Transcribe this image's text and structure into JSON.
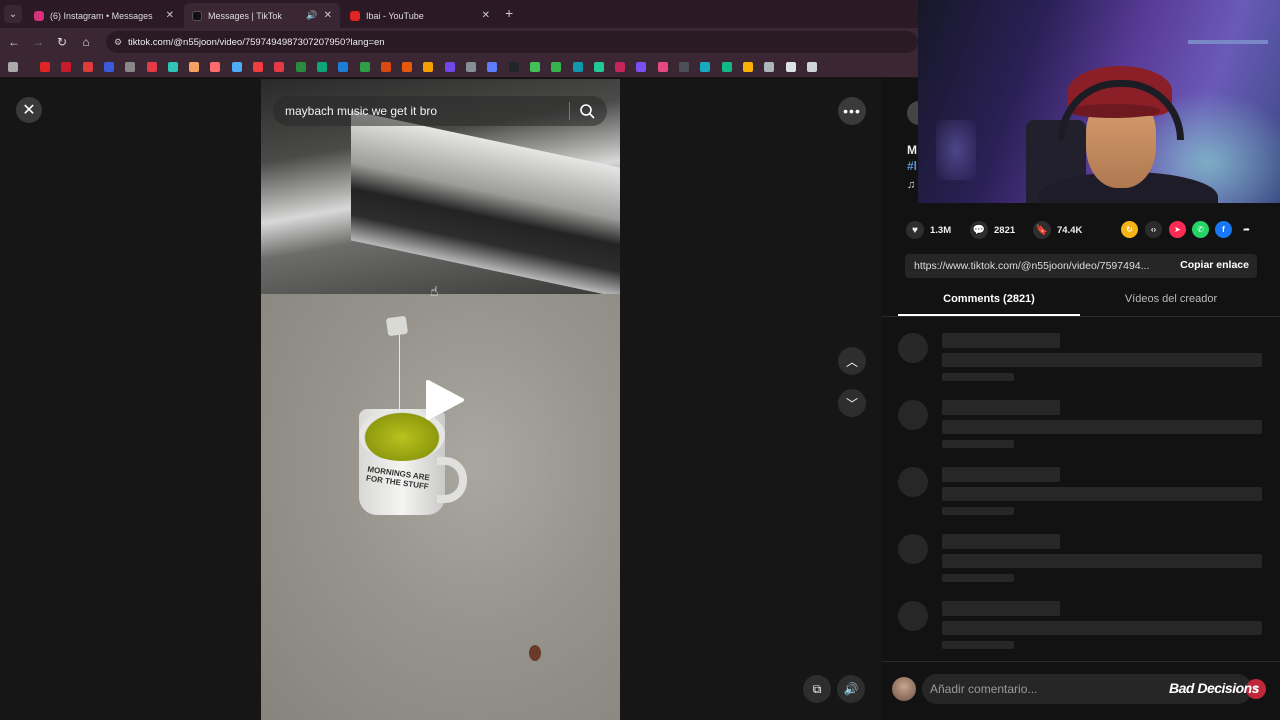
{
  "browser": {
    "tabs": [
      {
        "label": "(6) Instagram • Messages",
        "favicon_color": "#d6307a"
      },
      {
        "label": "Messages | TikTok",
        "favicon_color": "#111111"
      },
      {
        "label": "Ibai - YouTube",
        "favicon_color": "#e02424"
      }
    ],
    "close_glyph": "✕",
    "new_tab_glyph": "+",
    "url": "tiktok.com/@n55joon/video/7597494987307207950?lang=en",
    "bookmark_colors": [
      "#e02424",
      "#c81c2c",
      "#e03a3a",
      "#3b5bdb",
      "#888888",
      "#e63946",
      "#2ec4b6",
      "#f4a261",
      "#ff6b6b",
      "#4dabf7",
      "#f03e3e",
      "#e63946",
      "#2b8a3e",
      "#0ca678",
      "#1c7ed6",
      "#2f9e44",
      "#d9480f",
      "#e8590c",
      "#f59f00",
      "#7048e8",
      "#868e96",
      "#5c7cfa",
      "#212529",
      "#40c057",
      "#37b24d",
      "#1098ad",
      "#20c997",
      "#c2255c",
      "#7950f2",
      "#e64980",
      "#495057",
      "#15aabf",
      "#12b886",
      "#fab005",
      "#adb5bd",
      "#dee2e6",
      "#ced4da"
    ]
  },
  "video": {
    "search_text": "maybach music we get it bro",
    "mug_text": "MORNINGS ARE FOR THE STUFF"
  },
  "panel": {
    "author_fragment": "M",
    "tag_fragment": "#l",
    "music_fragment": "♫",
    "likes": "1.3M",
    "comments": "2821",
    "saves": "74.4K",
    "link": "https://www.tiktok.com/@n55joon/video/7597494...",
    "copy_label": "Copiar enlace",
    "tab_comments": "Comments (2821)",
    "tab_videos": "Vídeos del creador",
    "comment_placeholder": "Añadir comentario...",
    "watermark": "Bad Decisions",
    "share_colors": [
      "#f5b316",
      "#2b2b2b",
      "#fe2c55",
      "#25d366",
      "#1877f2"
    ]
  }
}
